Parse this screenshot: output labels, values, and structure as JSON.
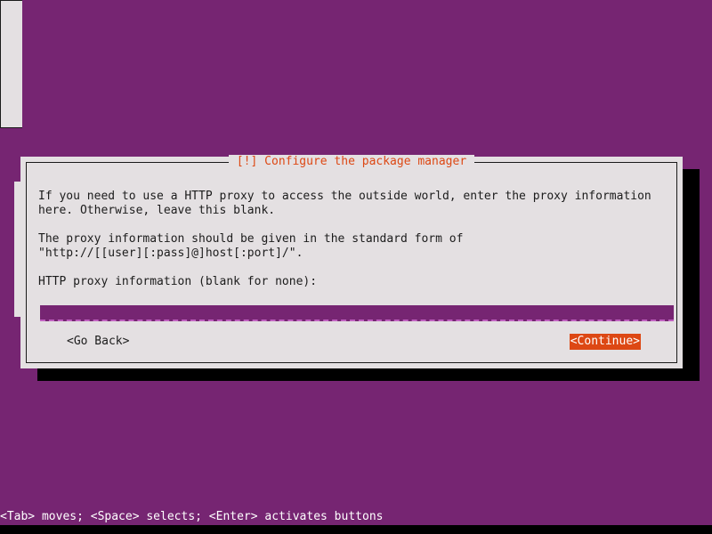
{
  "screen": {
    "background_color": "#762572",
    "accent_color": "#dd4814",
    "panel_color": "#e4e0e2",
    "field_color": "#762572",
    "field_dash_color": "#c061c0"
  },
  "dialog": {
    "title": "[!] Configure the package manager",
    "paragraphs": [
      "If you need to use a HTTP proxy to access the outside world, enter the proxy information",
      "here. Otherwise, leave this blank.",
      "The proxy information should be given in the standard form of",
      "\"http://[[user][:pass]@]host[:port]/\".",
      "HTTP proxy information (blank for none):"
    ],
    "field": {
      "label": "HTTP proxy information (blank for none):",
      "value": "",
      "placeholder": ""
    },
    "buttons": {
      "go_back": "<Go Back>",
      "continue": "<Continue>"
    }
  },
  "status_bar": {
    "text": "<Tab> moves; <Space> selects; <Enter> activates buttons"
  }
}
